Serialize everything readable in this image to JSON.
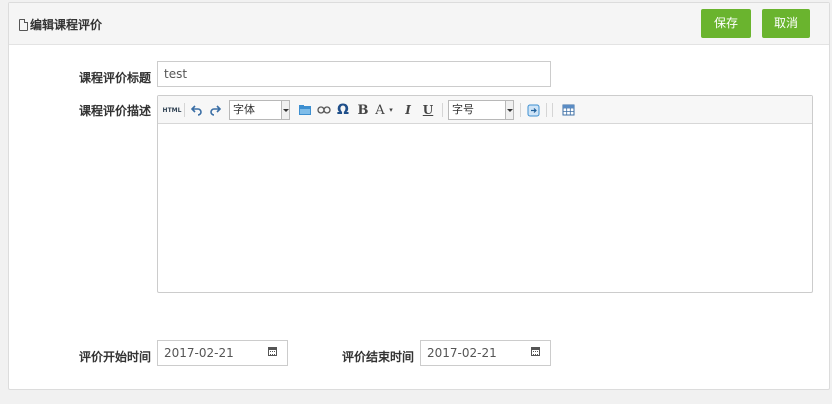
{
  "panel": {
    "title": "编辑课程评价",
    "save_label": "保存",
    "cancel_label": "取消"
  },
  "form": {
    "title_label": "课程评价标题",
    "title_value": "test",
    "desc_label": "课程评价描述",
    "start_label": "评价开始时间",
    "start_value": "2017-02-21",
    "end_label": "评价结束时间",
    "end_value": "2017-02-21"
  },
  "editor": {
    "toolbar": {
      "html_label": "HTML",
      "font_family": "字体",
      "font_size": "字号",
      "bold": "B",
      "font_color": "A",
      "italic": "I",
      "underline": "U",
      "special_char": "Ω"
    },
    "content": ""
  },
  "colors": {
    "accent": "#6ab42e"
  }
}
